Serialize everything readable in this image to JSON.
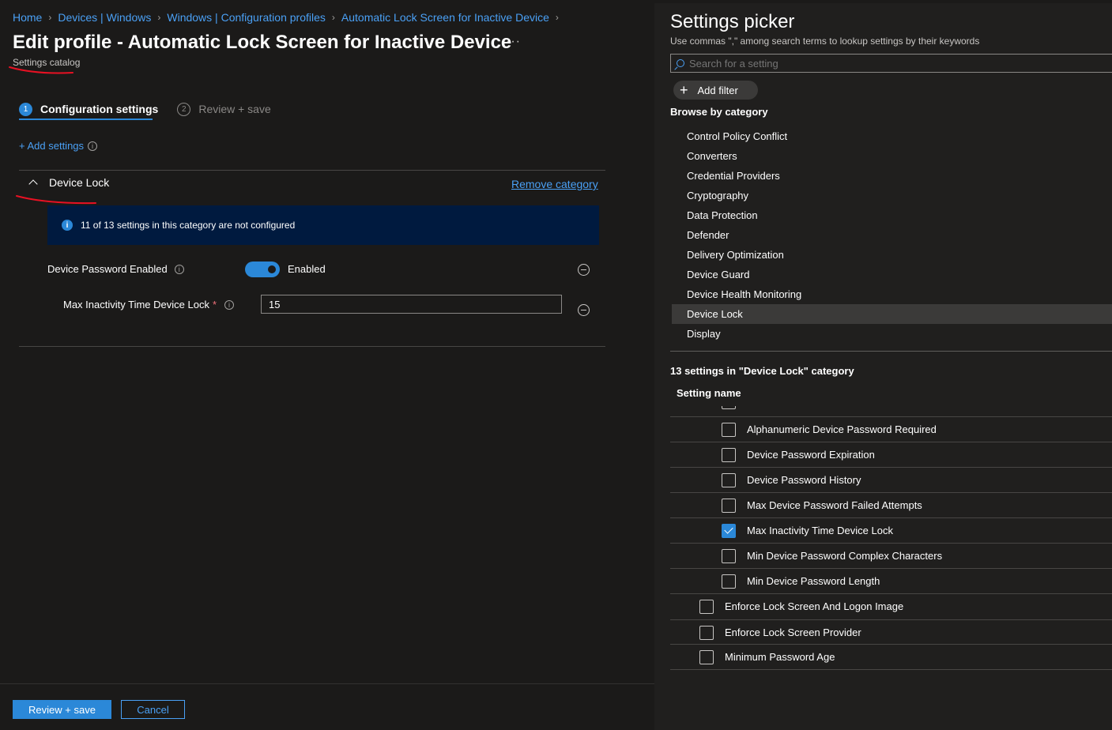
{
  "breadcrumb": [
    {
      "label": "Home"
    },
    {
      "label": "Devices | Windows"
    },
    {
      "label": "Windows | Configuration profiles"
    },
    {
      "label": "Automatic Lock Screen for Inactive Device"
    }
  ],
  "header": {
    "title": "Edit profile - Automatic Lock Screen for Inactive Device",
    "more": "···",
    "subtitle": "Settings catalog"
  },
  "steps": [
    {
      "num": "1",
      "label": "Configuration settings"
    },
    {
      "num": "2",
      "label": "Review + save"
    }
  ],
  "add_settings": {
    "label": "+ Add settings",
    "info": "i"
  },
  "category": {
    "name": "Device Lock",
    "remove_label": "Remove category",
    "banner_icon": "i",
    "banner_text": "11 of 13 settings in this category are not configured"
  },
  "settings": {
    "password_enabled": {
      "label": "Device Password Enabled",
      "info": "i",
      "toggle_on": true,
      "value_text": "Enabled"
    },
    "max_inactivity": {
      "label": "Max Inactivity Time Device Lock",
      "required": "*",
      "info": "i",
      "value": "15"
    }
  },
  "footer": {
    "primary": "Review + save",
    "secondary": "Cancel"
  },
  "picker": {
    "title": "Settings picker",
    "hint": "Use commas \",\" among search terms to lookup settings by their keywords",
    "search_placeholder": "Search for a setting",
    "add_filter": "Add filter",
    "add_filter_icon": "+",
    "browse_label": "Browse by category",
    "categories": [
      "Control Policy Conflict",
      "Converters",
      "Credential Providers",
      "Cryptography",
      "Data Protection",
      "Defender",
      "Delivery Optimization",
      "Device Guard",
      "Device Health Monitoring",
      "Device Lock",
      "Display"
    ],
    "selected_category": "Device Lock",
    "count_label": "13 settings in \"Device Lock\" category",
    "column_header": "Setting name",
    "settings": [
      {
        "label": "Alphanumeric Device Password Required",
        "checked": false,
        "indent": "child"
      },
      {
        "label": "Device Password Expiration",
        "checked": false,
        "indent": "child"
      },
      {
        "label": "Device Password History",
        "checked": false,
        "indent": "child"
      },
      {
        "label": "Max Device Password Failed Attempts",
        "checked": false,
        "indent": "child"
      },
      {
        "label": "Max Inactivity Time Device Lock",
        "checked": true,
        "indent": "child"
      },
      {
        "label": "Min Device Password Complex Characters",
        "checked": false,
        "indent": "child"
      },
      {
        "label": "Min Device Password Length",
        "checked": false,
        "indent": "child"
      },
      {
        "label": "Enforce Lock Screen And Logon Image",
        "checked": false,
        "indent": "top"
      },
      {
        "label": "Enforce Lock Screen Provider",
        "checked": false,
        "indent": "top"
      },
      {
        "label": "Minimum Password Age",
        "checked": false,
        "indent": "top"
      }
    ]
  },
  "colors": {
    "accent": "#2b88d8",
    "link": "#4aa0f5",
    "background": "#1b1a19",
    "banner": "#001a3f",
    "annotation": "#e81123"
  }
}
